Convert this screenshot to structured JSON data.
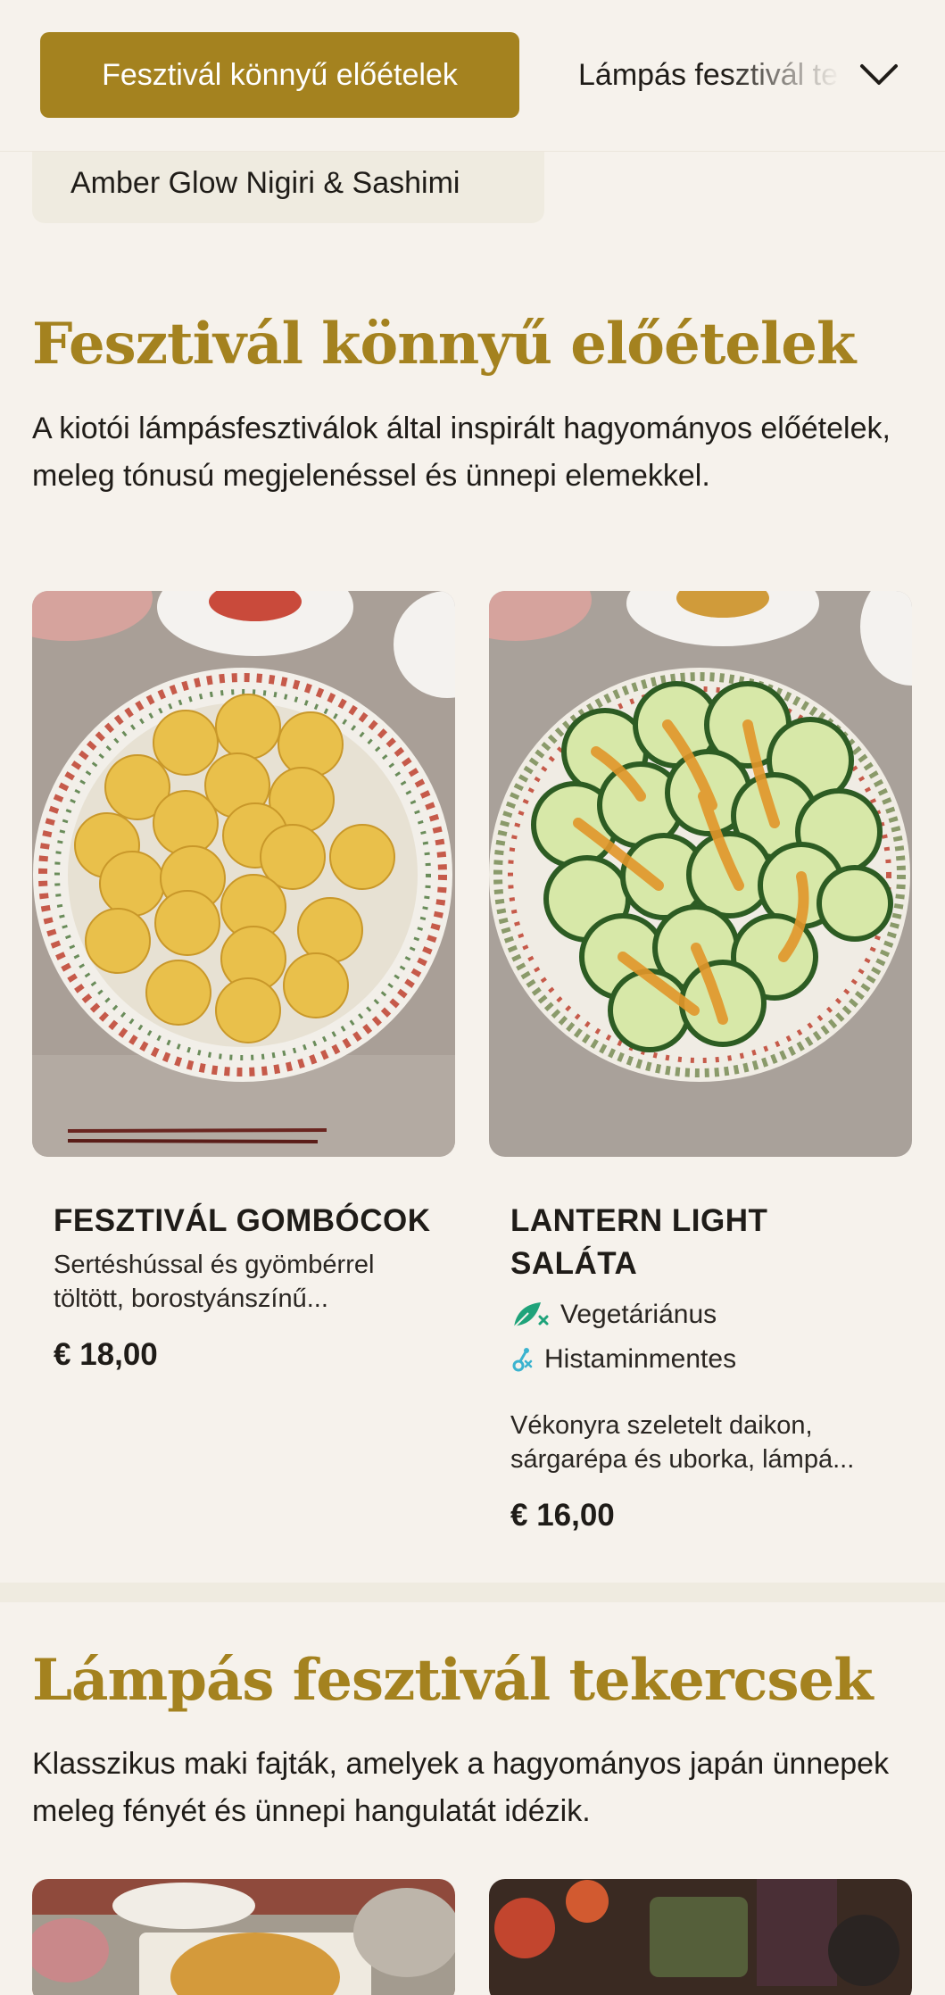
{
  "nav": {
    "active_tab": "Fesztivál könnyű előételek",
    "next_tab": "Lámpás fesztivál tekercsek",
    "dropdown_icon": "chevron-down-icon"
  },
  "sub_category": "Amber Glow Nigiri & Sashimi",
  "sections": [
    {
      "title": "Fesztivál könnyű előételek",
      "description": "A kiotói lámpásfesztiválok által inspirált hagyományos előételek, meleg tónusú megjelenéssel és ünnepi elemekkel.",
      "items": [
        {
          "name": "FESZTIVÁL GOMBÓCOK",
          "description": "Sertéshússal és gyömbérrel töltött, borostyánszínű...",
          "price": "€ 18,00",
          "tags": []
        },
        {
          "name": "LANTERN LIGHT SALÁTA",
          "tags": [
            {
              "label": "Vegetáriánus",
              "icon": "leaf-icon",
              "color": "#1fa37a"
            },
            {
              "label": "Histaminmentes",
              "icon": "histamine-free-icon",
              "color": "#3bb3cf"
            }
          ],
          "description": "Vékonyra szeletelt daikon, sárgarépa és uborka, lámpá...",
          "price": "€ 16,00"
        }
      ]
    },
    {
      "title": "Lámpás fesztivál tekercsek",
      "description": "Klasszikus maki fajták, amelyek a hagyományos japán ünnepek meleg fényét és ünnepi hangulatát idézik."
    }
  ],
  "colors": {
    "accent": "#a4821f",
    "background": "#f6f2ec",
    "pill": "#efebe0",
    "text": "#1f1c18"
  }
}
